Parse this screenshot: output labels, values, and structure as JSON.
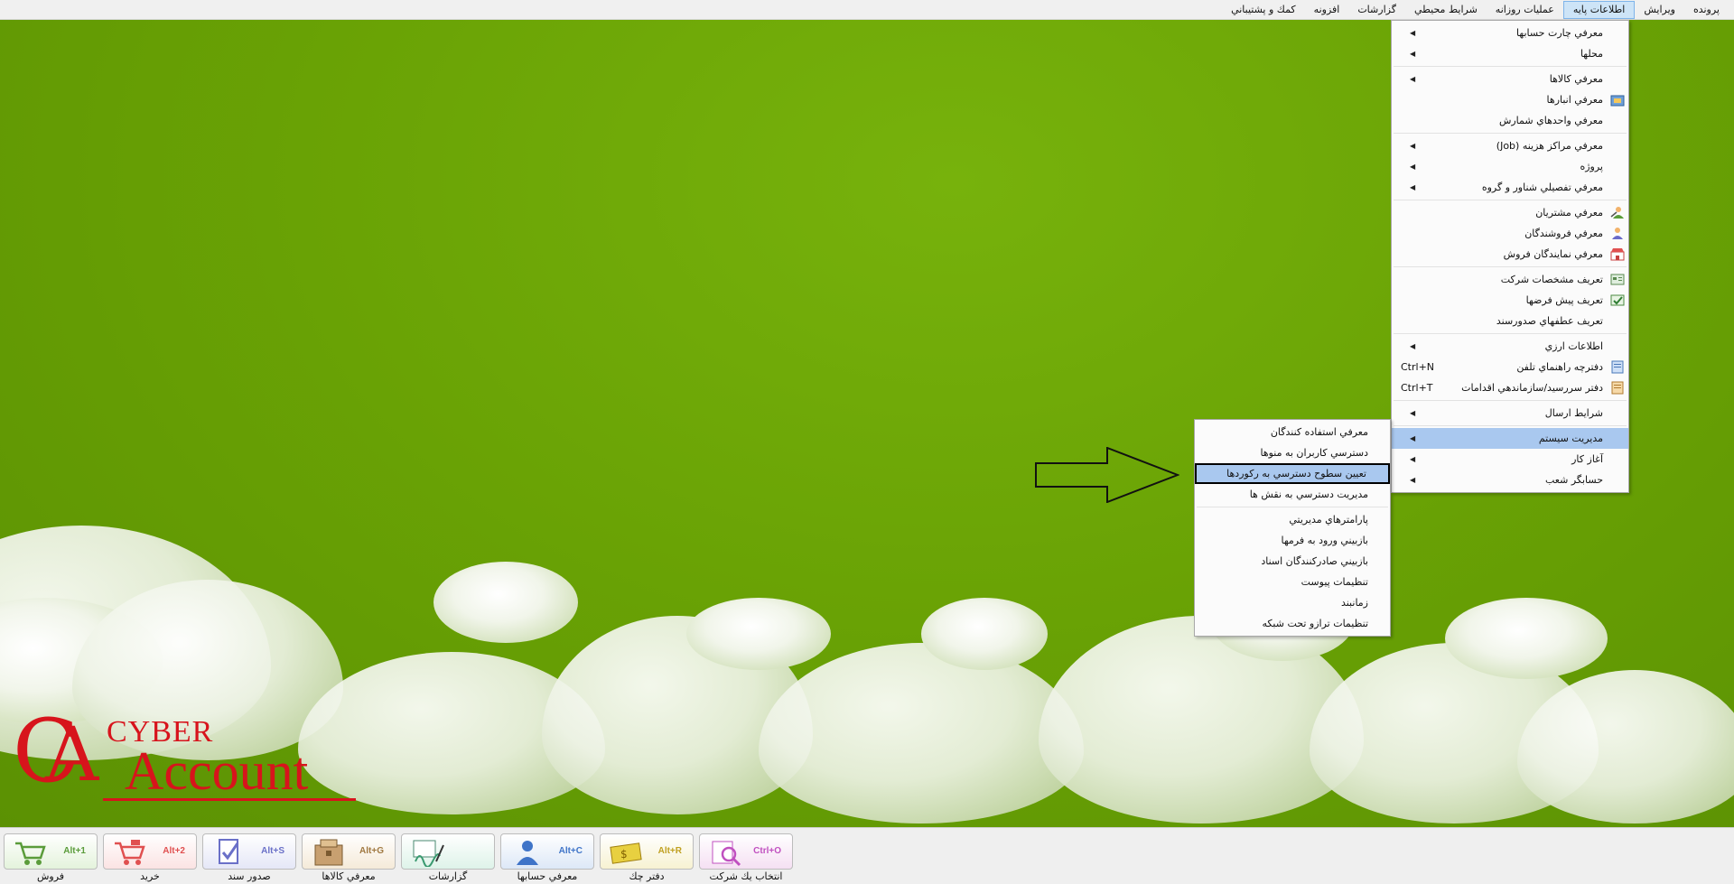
{
  "menubar": {
    "items": [
      {
        "label": "پرونده",
        "active": false
      },
      {
        "label": "ويرايش",
        "active": false
      },
      {
        "label": "اطلاعات پايه",
        "active": true
      },
      {
        "label": "عمليات روزانه",
        "active": false
      },
      {
        "label": "شرايط محيطي",
        "active": false
      },
      {
        "label": "گزارشات",
        "active": false
      },
      {
        "label": "افزونه",
        "active": false
      },
      {
        "label": "كمك و پشتيباني",
        "active": false
      }
    ]
  },
  "dropdown": {
    "items": [
      {
        "label": "معرفي چارت حسابها",
        "submenu": true
      },
      {
        "label": "محلها",
        "submenu": true
      },
      {
        "sep": true
      },
      {
        "label": "معرفي كالاها",
        "submenu": true
      },
      {
        "label": "معرفي انبارها",
        "icon": "warehouse-icon"
      },
      {
        "label": "معرفي  واحدهاي شمارش"
      },
      {
        "sep": true
      },
      {
        "label": "معرفي مراكز هزينه (Job)",
        "submenu": true
      },
      {
        "label": "پروژه",
        "submenu": true
      },
      {
        "label": "معرفي تفصيلي شناور و گروه",
        "submenu": true
      },
      {
        "sep": true
      },
      {
        "label": "معرفي مشتريان",
        "icon": "customer-icon"
      },
      {
        "label": "معرفي فروشندگان",
        "icon": "seller-icon"
      },
      {
        "label": "معرفي نمايندگان فروش",
        "icon": "shop-icon"
      },
      {
        "sep": true
      },
      {
        "label": "تعريف مشخصات شركت",
        "icon": "company-icon"
      },
      {
        "label": "تعريف پيش فرضها",
        "icon": "defaults-icon"
      },
      {
        "label": "تعريف عطفهاي صدورسند"
      },
      {
        "sep": true
      },
      {
        "label": "اطلاعات ارزي",
        "submenu": true
      },
      {
        "label": "دفترچه راهنماي تلفن",
        "icon": "phonebook-icon",
        "shortcut": "Ctrl+N"
      },
      {
        "label": "دفتر سررسيد/سازماندهي اقدامات",
        "icon": "planner-icon",
        "shortcut": "Ctrl+T"
      },
      {
        "sep": true
      },
      {
        "label": "شرايط ارسال",
        "submenu": true
      },
      {
        "sep": true
      },
      {
        "label": "مديريت سيستم",
        "submenu": true,
        "highlight": true
      },
      {
        "label": "آغاز كار",
        "submenu": true
      },
      {
        "label": "حسابگر شعب",
        "submenu": true
      }
    ]
  },
  "submenu": {
    "items": [
      {
        "label": "معرفي استفاده كنندگان"
      },
      {
        "label": "دسترسي كاربران به منوها"
      },
      {
        "label": "تعيين سطوح دسترسي به ركوردها",
        "selected": true
      },
      {
        "label": "مديريت دسترسي به نقش ها"
      },
      {
        "sep": true
      },
      {
        "label": "پارامترهاي مديريتي"
      },
      {
        "label": "بازبيني ورود به فرمها"
      },
      {
        "label": "بازبيني صادركنندگان اسناد"
      },
      {
        "label": "تنظيمات پيوست"
      },
      {
        "label": "زمانبند"
      },
      {
        "label": "تنظيمات ترازو تحت شبكه"
      }
    ]
  },
  "logo": {
    "c": "C",
    "a": "A",
    "cyber": "CYBER",
    "account": "Account"
  },
  "taskbar": {
    "buttons": [
      {
        "label": "فروش",
        "hotkey": "Alt+1",
        "icon": "cart-icon",
        "bg": "#e4f3dc",
        "hk_color": "#5a9c3a"
      },
      {
        "label": "خريد",
        "hotkey": "Alt+2",
        "icon": "cart-red-icon",
        "bg": "#fbe3e3",
        "hk_color": "#e05050"
      },
      {
        "label": "صدور سند",
        "hotkey": "Alt+S",
        "icon": "document-check-icon",
        "bg": "#e5e7f7",
        "hk_color": "#6a70c8"
      },
      {
        "label": "معرفي كالاها",
        "hotkey": "Alt+G",
        "icon": "boxes-icon",
        "bg": "#f5ead9",
        "hk_color": "#a07840"
      },
      {
        "label": "گزارشات",
        "hotkey": "",
        "icon": "report-pen-icon",
        "bg": "#def3e9",
        "hk_color": "#3a9a70"
      },
      {
        "label": "معرفي حسابها",
        "hotkey": "Alt+C",
        "icon": "person-icon",
        "bg": "#dde8f7",
        "hk_color": "#3f74c8"
      },
      {
        "label": "دفتر چك",
        "hotkey": "Alt+R",
        "icon": "cheque-icon",
        "bg": "#f7f2d2",
        "hk_color": "#c0a020"
      },
      {
        "label": "انتخاب يك شركت",
        "hotkey": "Ctrl+O",
        "icon": "search-company-icon",
        "bg": "#f5e0f3",
        "hk_color": "#c050c0"
      }
    ]
  }
}
